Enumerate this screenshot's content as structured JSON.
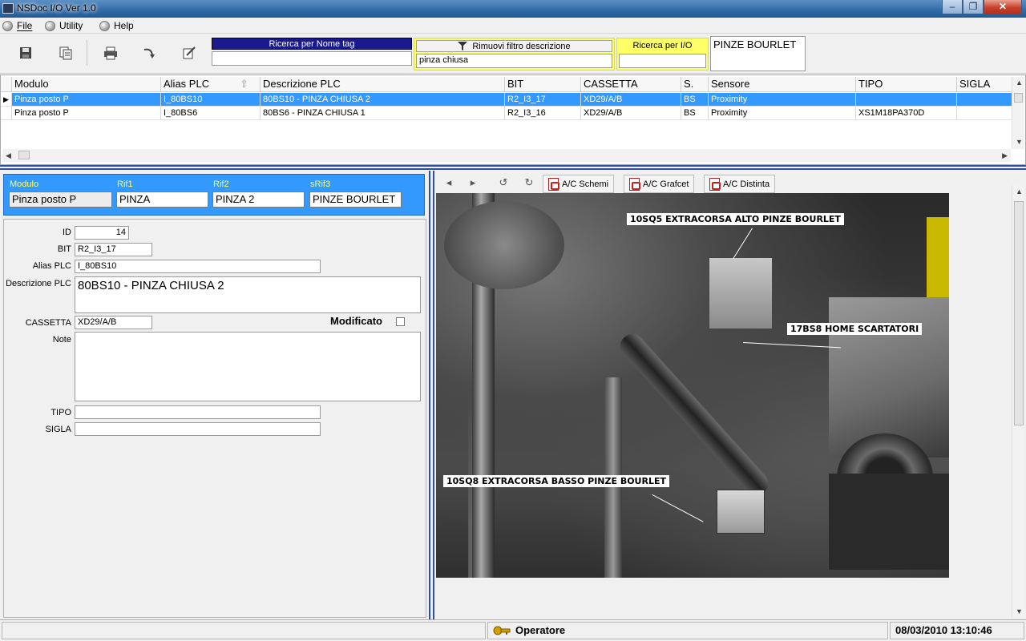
{
  "window": {
    "title": "NSDoc I/O Ver 1.0"
  },
  "menu": {
    "items": [
      "File",
      "Utility",
      "Help"
    ]
  },
  "toolbar": {
    "search_tag_label": "Ricerca per Nome tag",
    "search_tag_value": "",
    "filter_desc_label": "Rimuovi filtro descrizione",
    "filter_desc_value": "pinza chiusa",
    "search_io_label": "Ricerca per I/O",
    "search_io_value": "",
    "current_tag": "PINZE BOURLET"
  },
  "grid": {
    "columns": [
      "Modulo",
      "Alias PLC",
      "Descrizione PLC",
      "BIT",
      "CASSETTA",
      "S.",
      "Sensore",
      "TIPO",
      "SIGLA"
    ],
    "rows": [
      [
        "Pinza posto P",
        "I_80BS10",
        "80BS10 - PINZA CHIUSA 2",
        "R2_I3_17",
        "XD29/A/B",
        "BS",
        "Proximity",
        "",
        ""
      ],
      [
        "Pinza posto P",
        "I_80BS6",
        "80BS6 - PINZA CHIUSA 1",
        "R2_I3_16",
        "XD29/A/B",
        "BS",
        "Proximity",
        "XS1M18PA370D",
        ""
      ]
    ],
    "selected_row": 0
  },
  "header_panel": {
    "modulo_label": "Modulo",
    "modulo_value": "Pinza posto P",
    "rif1_label": "Rif1",
    "rif1_value": "PINZA",
    "rif2_label": "Rif2",
    "rif2_value": "PINZA 2",
    "srif3_label": "sRif3",
    "srif3_value": "PINZE BOURLET"
  },
  "detail": {
    "id_label": "ID",
    "id_value": "14",
    "bit_label": "BIT",
    "bit_value": "R2_I3_17",
    "alias_label": "Alias PLC",
    "alias_value": "I_80BS10",
    "desc_label": "Descrizione PLC",
    "desc_value": "80BS10 - PINZA CHIUSA 2",
    "cassetta_label": "CASSETTA",
    "cassetta_value": "XD29/A/B",
    "modificato_label": "Modificato",
    "modificato_checked": false,
    "note_label": "Note",
    "note_value": "",
    "tipo_label": "TIPO",
    "tipo_value": "",
    "sigla_label": "SIGLA",
    "sigla_value": ""
  },
  "viewer": {
    "schemi_label": "A/C Schemi",
    "grafcet_label": "A/C Grafcet",
    "distinta_label": "A/C Distinta",
    "callouts": [
      "10SQ5 EXTRACORSA ALTO PINZE BOURLET",
      "17BS8 HOME SCARTATORI",
      "10SQ8 EXTRACORSA BASSO PINZE BOURLET"
    ]
  },
  "status": {
    "user": "Operatore",
    "datetime": "08/03/2010 13:10:46"
  },
  "colors": {
    "selection": "#3399ff",
    "header_panel_bg": "#3399ff",
    "header_label": "#ffff66",
    "splitter": "#2f4fa0"
  },
  "icons": [
    "save-icon",
    "copy-document-icon",
    "print-icon",
    "redo-icon",
    "edit-icon",
    "funnel-icon",
    "sort-up-icon",
    "arrow-left-icon",
    "arrow-right-icon",
    "rotate-left-icon",
    "rotate-right-icon",
    "pdf-icon",
    "key-icon"
  ]
}
